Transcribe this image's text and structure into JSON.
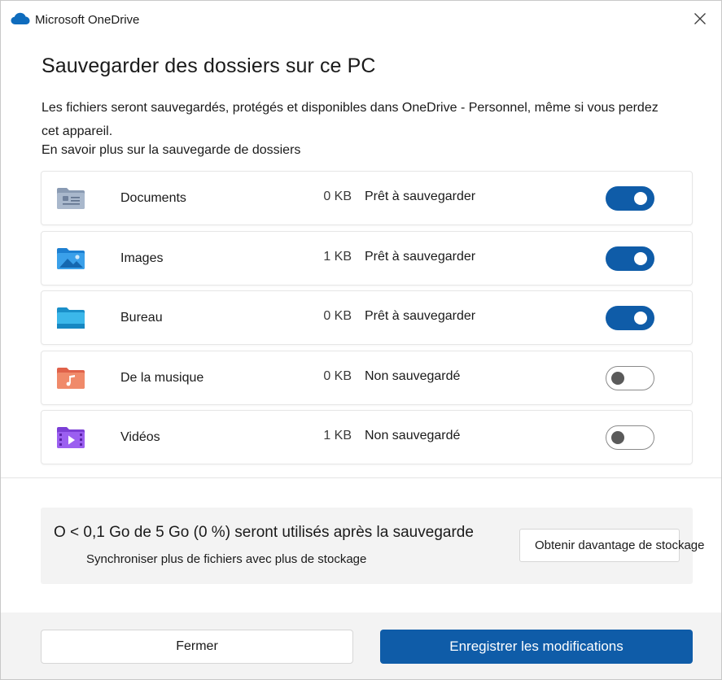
{
  "titlebar": {
    "app_title": "Microsoft OneDrive",
    "close_icon": "close-icon",
    "app_icon": "onedrive-cloud-icon"
  },
  "content": {
    "heading": "Sauvegarder des dossiers sur ce PC",
    "description": "Les fichiers seront sauvegardés, protégés et disponibles dans OneDrive - Personnel, même si vous perdez cet appareil.",
    "learn_more": "En savoir plus sur la sauvegarde de dossiers"
  },
  "folders": [
    {
      "name": "Documents",
      "size": "0 KB",
      "status": "Prêt à sauvegarder",
      "enabled": true,
      "icon": "documents-folder-icon"
    },
    {
      "name": "Images",
      "size": "1 KB",
      "status": "Prêt à sauvegarder",
      "enabled": true,
      "icon": "pictures-folder-icon"
    },
    {
      "name": "Bureau",
      "size": "0 KB",
      "status": "Prêt à sauvegarder",
      "enabled": true,
      "icon": "desktop-folder-icon"
    },
    {
      "name": "De la musique",
      "size": "0 KB",
      "status": "Non sauvegardé",
      "enabled": false,
      "icon": "music-folder-icon"
    },
    {
      "name": "Vidéos",
      "size": "1 KB",
      "status": "Non sauvegardé",
      "enabled": false,
      "icon": "videos-folder-icon"
    }
  ],
  "storage": {
    "summary": "O < 0,1 Go de 5 Go (0 %) seront utilisés après la sauvegarde",
    "subtext": "Synchroniser plus de fichiers avec plus de stockage",
    "button_label": "Obtenir davantage de stockage"
  },
  "footer": {
    "close_label": "Fermer",
    "save_label": "Enregistrer les modifications"
  },
  "colors": {
    "accent": "#0f5ca8",
    "toggle_off_border": "#8a8a8a",
    "panel_background": "#f3f3f3"
  }
}
